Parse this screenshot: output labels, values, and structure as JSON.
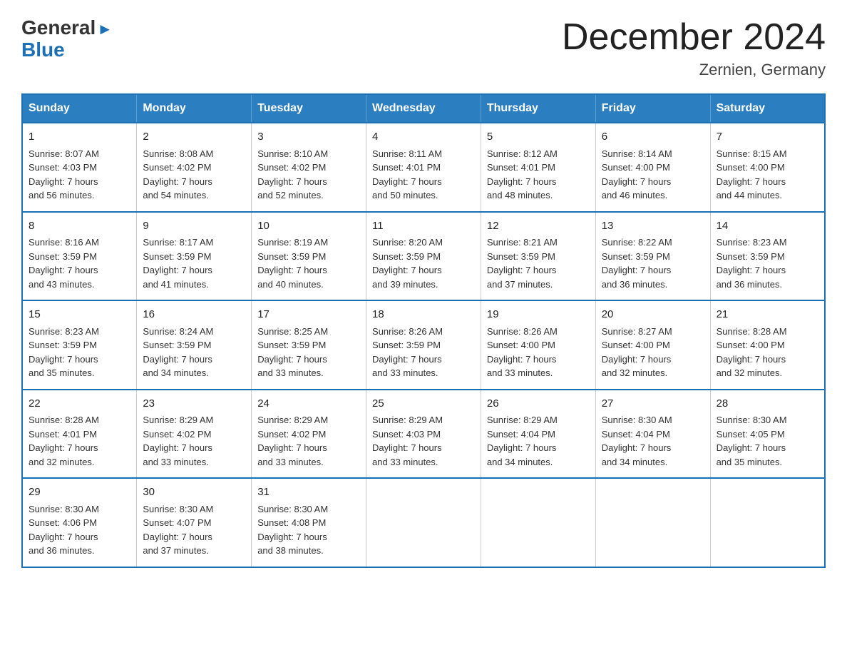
{
  "logo": {
    "general": "General",
    "blue": "Blue",
    "arrow": "▶"
  },
  "title": "December 2024",
  "subtitle": "Zernien, Germany",
  "weekdays": [
    "Sunday",
    "Monday",
    "Tuesday",
    "Wednesday",
    "Thursday",
    "Friday",
    "Saturday"
  ],
  "weeks": [
    [
      {
        "num": "1",
        "info": "Sunrise: 8:07 AM\nSunset: 4:03 PM\nDaylight: 7 hours\nand 56 minutes."
      },
      {
        "num": "2",
        "info": "Sunrise: 8:08 AM\nSunset: 4:02 PM\nDaylight: 7 hours\nand 54 minutes."
      },
      {
        "num": "3",
        "info": "Sunrise: 8:10 AM\nSunset: 4:02 PM\nDaylight: 7 hours\nand 52 minutes."
      },
      {
        "num": "4",
        "info": "Sunrise: 8:11 AM\nSunset: 4:01 PM\nDaylight: 7 hours\nand 50 minutes."
      },
      {
        "num": "5",
        "info": "Sunrise: 8:12 AM\nSunset: 4:01 PM\nDaylight: 7 hours\nand 48 minutes."
      },
      {
        "num": "6",
        "info": "Sunrise: 8:14 AM\nSunset: 4:00 PM\nDaylight: 7 hours\nand 46 minutes."
      },
      {
        "num": "7",
        "info": "Sunrise: 8:15 AM\nSunset: 4:00 PM\nDaylight: 7 hours\nand 44 minutes."
      }
    ],
    [
      {
        "num": "8",
        "info": "Sunrise: 8:16 AM\nSunset: 3:59 PM\nDaylight: 7 hours\nand 43 minutes."
      },
      {
        "num": "9",
        "info": "Sunrise: 8:17 AM\nSunset: 3:59 PM\nDaylight: 7 hours\nand 41 minutes."
      },
      {
        "num": "10",
        "info": "Sunrise: 8:19 AM\nSunset: 3:59 PM\nDaylight: 7 hours\nand 40 minutes."
      },
      {
        "num": "11",
        "info": "Sunrise: 8:20 AM\nSunset: 3:59 PM\nDaylight: 7 hours\nand 39 minutes."
      },
      {
        "num": "12",
        "info": "Sunrise: 8:21 AM\nSunset: 3:59 PM\nDaylight: 7 hours\nand 37 minutes."
      },
      {
        "num": "13",
        "info": "Sunrise: 8:22 AM\nSunset: 3:59 PM\nDaylight: 7 hours\nand 36 minutes."
      },
      {
        "num": "14",
        "info": "Sunrise: 8:23 AM\nSunset: 3:59 PM\nDaylight: 7 hours\nand 36 minutes."
      }
    ],
    [
      {
        "num": "15",
        "info": "Sunrise: 8:23 AM\nSunset: 3:59 PM\nDaylight: 7 hours\nand 35 minutes."
      },
      {
        "num": "16",
        "info": "Sunrise: 8:24 AM\nSunset: 3:59 PM\nDaylight: 7 hours\nand 34 minutes."
      },
      {
        "num": "17",
        "info": "Sunrise: 8:25 AM\nSunset: 3:59 PM\nDaylight: 7 hours\nand 33 minutes."
      },
      {
        "num": "18",
        "info": "Sunrise: 8:26 AM\nSunset: 3:59 PM\nDaylight: 7 hours\nand 33 minutes."
      },
      {
        "num": "19",
        "info": "Sunrise: 8:26 AM\nSunset: 4:00 PM\nDaylight: 7 hours\nand 33 minutes."
      },
      {
        "num": "20",
        "info": "Sunrise: 8:27 AM\nSunset: 4:00 PM\nDaylight: 7 hours\nand 32 minutes."
      },
      {
        "num": "21",
        "info": "Sunrise: 8:28 AM\nSunset: 4:00 PM\nDaylight: 7 hours\nand 32 minutes."
      }
    ],
    [
      {
        "num": "22",
        "info": "Sunrise: 8:28 AM\nSunset: 4:01 PM\nDaylight: 7 hours\nand 32 minutes."
      },
      {
        "num": "23",
        "info": "Sunrise: 8:29 AM\nSunset: 4:02 PM\nDaylight: 7 hours\nand 33 minutes."
      },
      {
        "num": "24",
        "info": "Sunrise: 8:29 AM\nSunset: 4:02 PM\nDaylight: 7 hours\nand 33 minutes."
      },
      {
        "num": "25",
        "info": "Sunrise: 8:29 AM\nSunset: 4:03 PM\nDaylight: 7 hours\nand 33 minutes."
      },
      {
        "num": "26",
        "info": "Sunrise: 8:29 AM\nSunset: 4:04 PM\nDaylight: 7 hours\nand 34 minutes."
      },
      {
        "num": "27",
        "info": "Sunrise: 8:30 AM\nSunset: 4:04 PM\nDaylight: 7 hours\nand 34 minutes."
      },
      {
        "num": "28",
        "info": "Sunrise: 8:30 AM\nSunset: 4:05 PM\nDaylight: 7 hours\nand 35 minutes."
      }
    ],
    [
      {
        "num": "29",
        "info": "Sunrise: 8:30 AM\nSunset: 4:06 PM\nDaylight: 7 hours\nand 36 minutes."
      },
      {
        "num": "30",
        "info": "Sunrise: 8:30 AM\nSunset: 4:07 PM\nDaylight: 7 hours\nand 37 minutes."
      },
      {
        "num": "31",
        "info": "Sunrise: 8:30 AM\nSunset: 4:08 PM\nDaylight: 7 hours\nand 38 minutes."
      },
      {
        "num": "",
        "info": ""
      },
      {
        "num": "",
        "info": ""
      },
      {
        "num": "",
        "info": ""
      },
      {
        "num": "",
        "info": ""
      }
    ]
  ]
}
